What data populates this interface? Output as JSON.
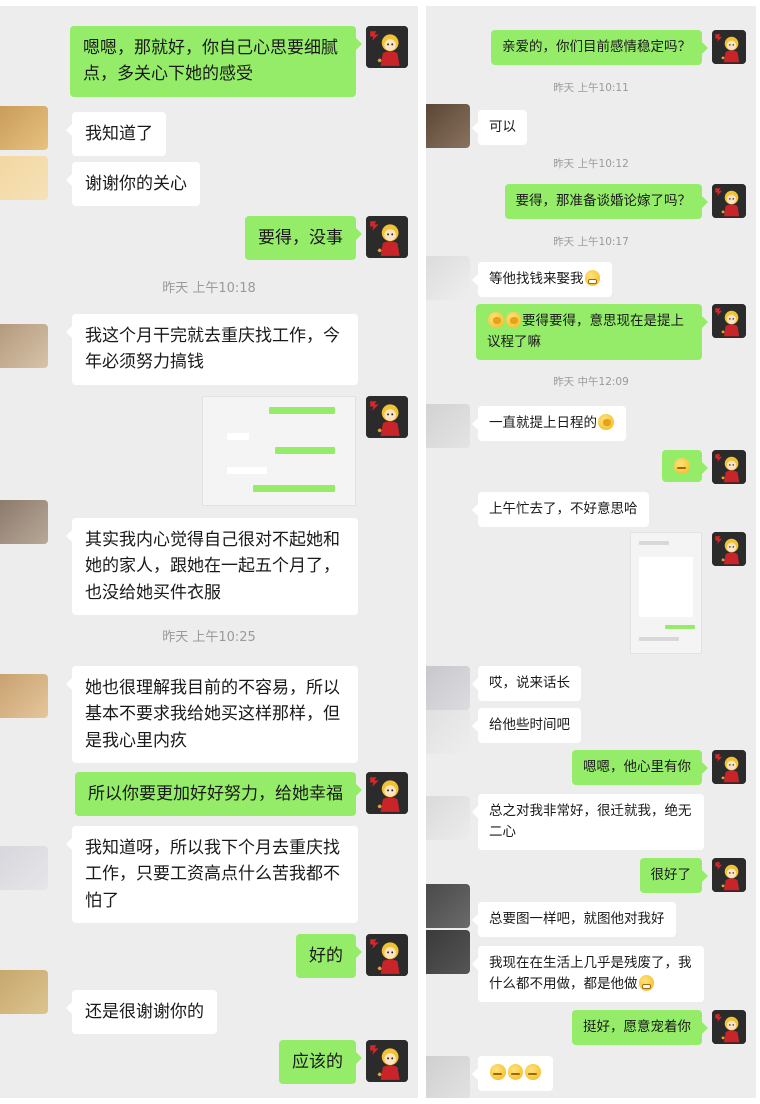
{
  "left": {
    "timestamps": [
      "昨天 上午10:18",
      "昨天 上午10:25"
    ],
    "messages": [
      "嗯嗯，那就好，你自己心思要细腻点，多关心下她的感受",
      "我知道了",
      "谢谢你的关心",
      "要得，没事",
      "我这个月干完就去重庆找工作，今年必须努力搞钱",
      "其实我内心觉得自己很对不起她和她的家人，跟她在一起五个月了，也没给她买件衣服",
      "她也很理解我目前的不容易，所以基本不要求我给她买这样那样，但是我心里内疚",
      "所以你要更加好好努力，给她幸福",
      "我知道呀，所以我下个月去重庆找工作，只要工资高点什么苦我都不怕了",
      "好的",
      "还是很谢谢你的",
      "应该的"
    ]
  },
  "right": {
    "timestamps": [
      "昨天 上午10:11",
      "昨天 上午10:12",
      "昨天 上午10:17",
      "昨天 中午12:09"
    ],
    "messages": [
      "亲爱的，你们目前感情稳定吗？",
      "可以",
      "要得，那准备谈婚论嫁了吗？",
      "等他找钱来娶我",
      "要得要得，意思现在是提上议程了嘛",
      "一直就提上日程的",
      "上午忙去了，不好意思哈",
      "哎，说来话长",
      "给他些时间吧",
      "嗯嗯，他心里有你",
      "总之对我非常好，很迁就我，绝无二心",
      "很好了",
      "总要图一样吧，就图他对我好",
      "我现在在生活上几乎是残废了，我什么都不用做，都是他做",
      "挺好，愿意宠着你"
    ]
  },
  "colors": {
    "sent_bubble": "#95ec69",
    "received_bubble": "#ffffff",
    "chat_background": "#ededed",
    "timestamp_text": "#9a9a9a"
  }
}
